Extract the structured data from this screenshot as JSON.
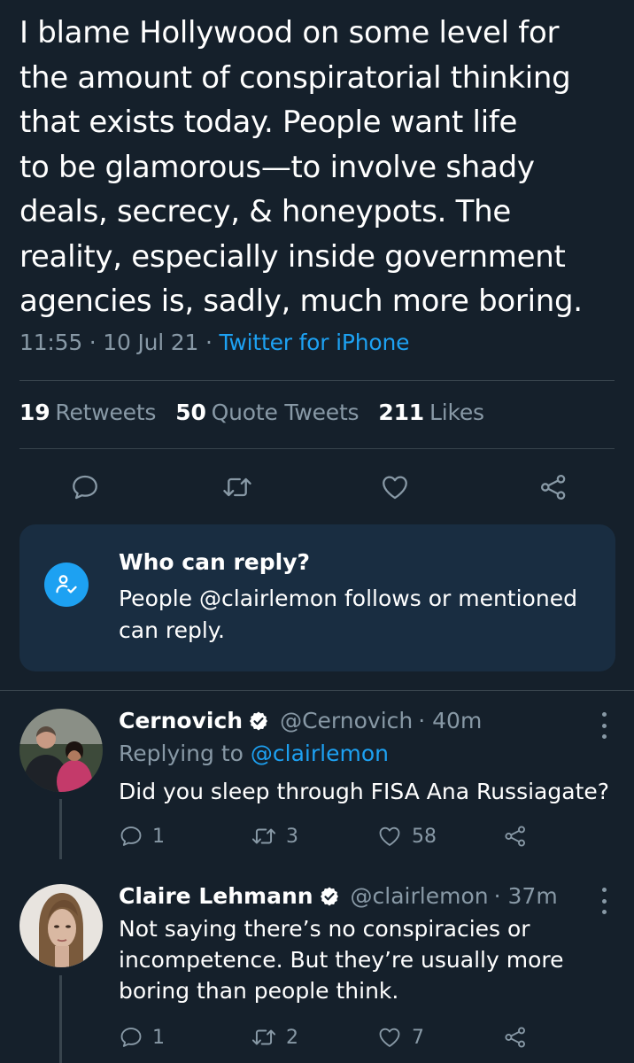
{
  "tweet": {
    "text": "I blame Hollywood on some level for\nthe amount of conspiratorial thinking\nthat exists today. People want life\nto be glamorous—to involve shady\ndeals, secrecy, & honeypots. The\nreality, especially inside government\nagencies is, sadly, much more boring.",
    "time": "11:55",
    "date": "10 Jul 21",
    "separator": "·",
    "source": "Twitter for iPhone"
  },
  "stats": {
    "retweets_count": "19",
    "retweets_label": "Retweets",
    "quotes_count": "50",
    "quotes_label": "Quote Tweets",
    "likes_count": "211",
    "likes_label": "Likes"
  },
  "actions": {
    "icons": [
      "comment-icon",
      "retweet-icon",
      "heart-icon",
      "share-icon"
    ]
  },
  "who_can_reply": {
    "title": "Who can reply?",
    "body": "People @clairlemon follows or mentioned can reply.",
    "icon": "person-check-icon"
  },
  "replies": [
    {
      "name": "Cernovich",
      "handle": "@Cernovich",
      "time": "· 40m",
      "replying_prefix": "Replying to",
      "replying_handle": "@clairlemon",
      "text": "Did you sleep through FISA Ana Russiagate?",
      "reply_count": "1",
      "retweet_count": "3",
      "like_count": "58"
    },
    {
      "name": "Claire Lehmann",
      "handle": "@clairlemon",
      "time": "· 37m",
      "text": "Not saying there’s no conspiracies or\nincompetence. But they’re usually more\nboring than people think.",
      "reply_count": "1",
      "retweet_count": "2",
      "like_count": "7"
    }
  ],
  "colors": {
    "background": "#15202b",
    "accent": "#1da1f2",
    "secondary_text": "#8899a6",
    "card": "#192d41",
    "divider": "#38444d"
  }
}
